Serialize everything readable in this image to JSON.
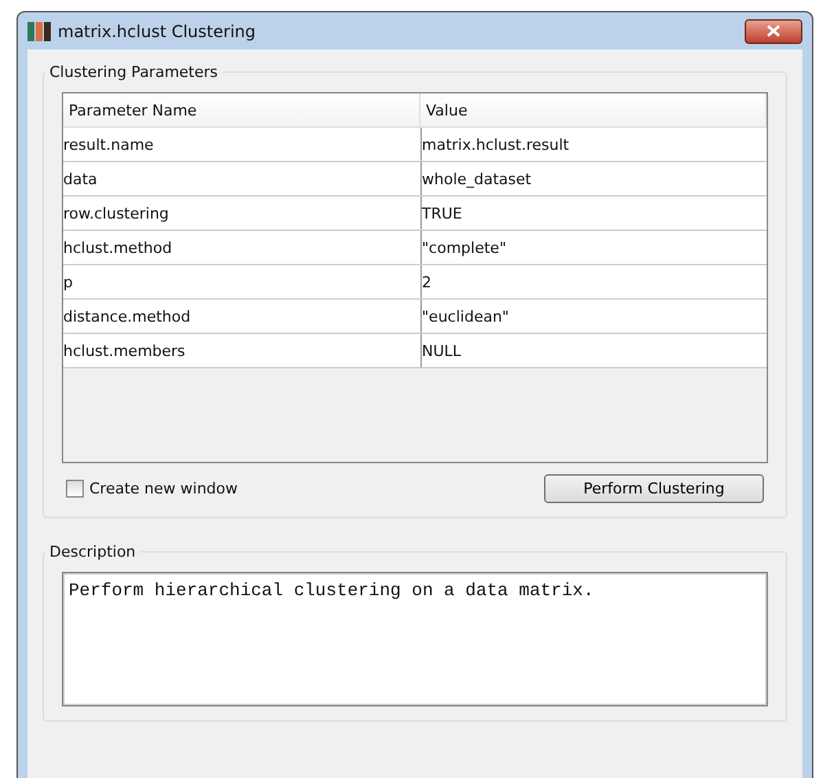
{
  "window": {
    "title": "matrix.hclust Clustering"
  },
  "parameters": {
    "legend": "Clustering Parameters",
    "columns": [
      "Parameter Name",
      "Value"
    ],
    "rows": [
      {
        "name": "result.name",
        "value": "matrix.hclust.result"
      },
      {
        "name": "data",
        "value": "whole_dataset"
      },
      {
        "name": "row.clustering",
        "value": "TRUE"
      },
      {
        "name": "hclust.method",
        "value": "\"complete\""
      },
      {
        "name": "p",
        "value": "2"
      },
      {
        "name": "distance.method",
        "value": "\"euclidean\""
      },
      {
        "name": "hclust.members",
        "value": "NULL"
      }
    ],
    "new_window": {
      "label": "Create new window",
      "checked": false
    },
    "button": "Perform Clustering"
  },
  "description": {
    "legend": "Description",
    "text": "Perform hierarchical clustering on a data matrix."
  }
}
